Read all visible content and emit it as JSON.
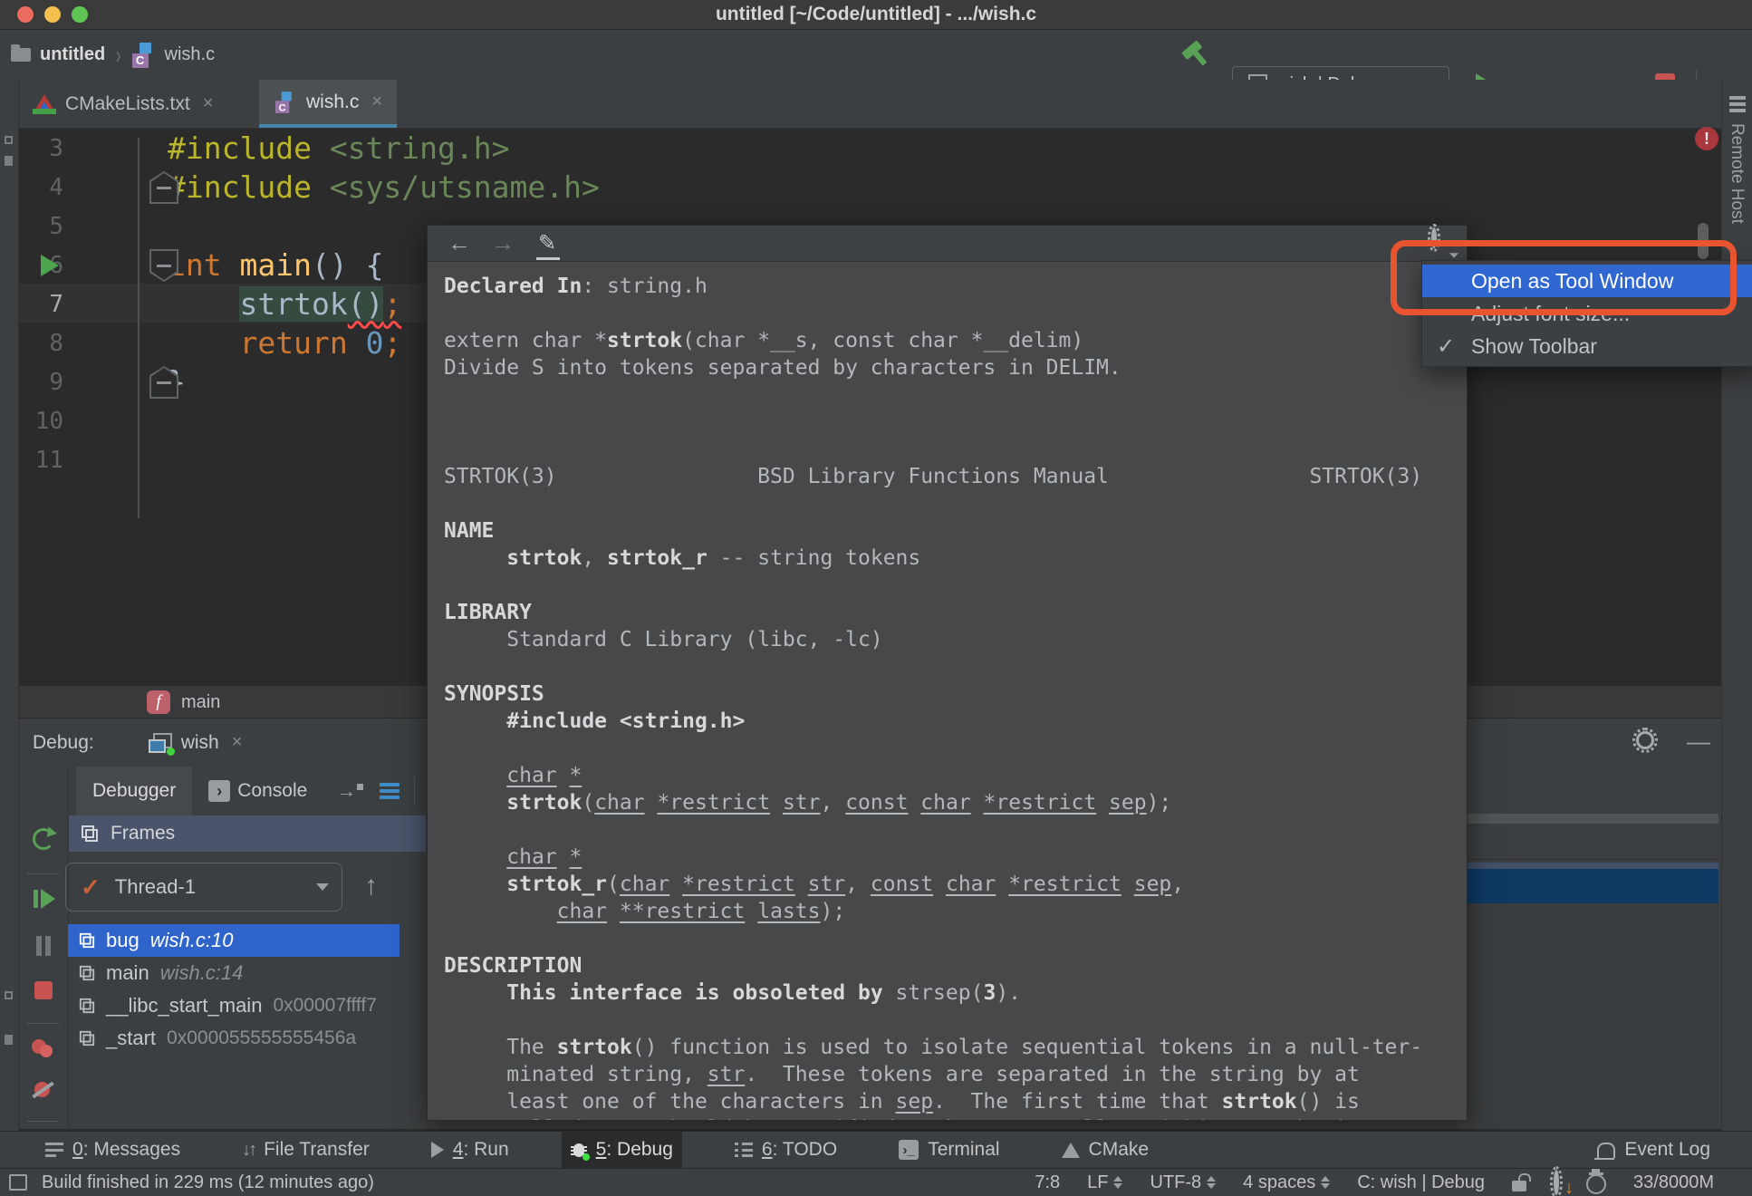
{
  "icons": {
    "back": "←",
    "forward": "→",
    "edit": "✎",
    "close": "×",
    "check": "✓",
    "chevrons": "››",
    "nav_up": "↑",
    "minimize": "—",
    "error_mark": "!",
    "breadcrumb_sep": "›",
    "console_prompt": "›",
    "terminal_prompt": "›_",
    "jump_arrow": "→",
    "file_transfer": "↓↑",
    "gear_down_arrow": "↓"
  },
  "titlebar": {
    "title": "untitled [~/Code/untitled] - .../wish.c"
  },
  "navbar": {
    "project": "untitled",
    "file": "wish.c",
    "run_config": "wish | Debug"
  },
  "editor_tabs": [
    {
      "label": "CMakeLists.txt"
    },
    {
      "label": "wish.c"
    }
  ],
  "editor": {
    "lines": [
      {
        "num": "3",
        "segments": [
          {
            "t": "#include",
            "type": "directive"
          },
          {
            "t": " ",
            "type": "plain"
          },
          {
            "t": "<string.h>",
            "type": "string"
          }
        ]
      },
      {
        "num": "4",
        "fold": "up",
        "segments": [
          {
            "t": "#include",
            "type": "directive"
          },
          {
            "t": " ",
            "type": "plain"
          },
          {
            "t": "<sys/utsname.h>",
            "type": "string"
          }
        ]
      },
      {
        "num": "5",
        "segments": []
      },
      {
        "num": "6",
        "run": true,
        "fold": "down",
        "segments": [
          {
            "t": "int",
            "type": "keyword"
          },
          {
            "t": " ",
            "type": "plain"
          },
          {
            "t": "main",
            "type": "function"
          },
          {
            "t": "() {",
            "type": "plain"
          }
        ]
      },
      {
        "num": "7",
        "current": true,
        "segments": [
          {
            "t": "    ",
            "type": "plain"
          },
          {
            "t": "strtok",
            "type": "plain",
            "hl": true
          },
          {
            "t": "()",
            "type": "plain",
            "hl": true,
            "sq": true
          },
          {
            "t": ";",
            "type": "keyword",
            "sq": true
          }
        ]
      },
      {
        "num": "8",
        "segments": [
          {
            "t": "    ",
            "type": "plain"
          },
          {
            "t": "return",
            "type": "keyword"
          },
          {
            "t": " ",
            "type": "plain"
          },
          {
            "t": "0",
            "type": "number"
          },
          {
            "t": ";",
            "type": "keyword"
          }
        ]
      },
      {
        "num": "9",
        "fold": "up",
        "segments": [
          {
            "t": "}",
            "type": "plain"
          }
        ]
      },
      {
        "num": "10",
        "segments": []
      },
      {
        "num": "11",
        "segments": []
      }
    ]
  },
  "breadcrumb": {
    "function": "main"
  },
  "popup": {
    "man_lines": [
      [
        {
          "t": "Declared In",
          "s": "b"
        },
        {
          "t": ": string.h",
          "s": "n"
        }
      ],
      [],
      [
        {
          "t": "extern char *",
          "s": "n"
        },
        {
          "t": "strtok",
          "s": "b"
        },
        {
          "t": "(char *__s, const char *__delim)",
          "s": "n"
        }
      ],
      [
        {
          "t": "Divide S into tokens separated by characters in DELIM.",
          "s": "n"
        }
      ],
      [],
      [],
      [],
      [
        {
          "t": "STRTOK(3)                BSD Library Functions Manual                STRTOK(3)",
          "s": "n"
        }
      ],
      [],
      [
        {
          "t": "NAME",
          "s": "b"
        }
      ],
      [
        {
          "t": "     ",
          "s": "n"
        },
        {
          "t": "strtok",
          "s": "b"
        },
        {
          "t": ", ",
          "s": "n"
        },
        {
          "t": "strtok_r",
          "s": "b"
        },
        {
          "t": " -- string tokens",
          "s": "n"
        }
      ],
      [],
      [
        {
          "t": "LIBRARY",
          "s": "b"
        }
      ],
      [
        {
          "t": "     Standard C Library (libc, -lc)",
          "s": "n"
        }
      ],
      [],
      [
        {
          "t": "SYNOPSIS",
          "s": "b"
        }
      ],
      [
        {
          "t": "     ",
          "s": "n"
        },
        {
          "t": "#include <string.h>",
          "s": "b"
        }
      ],
      [],
      [
        {
          "t": "     ",
          "s": "n"
        },
        {
          "t": "char",
          "s": "u"
        },
        {
          "t": " ",
          "s": "n"
        },
        {
          "t": "*",
          "s": "u"
        }
      ],
      [
        {
          "t": "     ",
          "s": "n"
        },
        {
          "t": "strtok",
          "s": "b"
        },
        {
          "t": "(",
          "s": "n"
        },
        {
          "t": "char",
          "s": "u"
        },
        {
          "t": " ",
          "s": "n"
        },
        {
          "t": "*restrict",
          "s": "u"
        },
        {
          "t": " ",
          "s": "n"
        },
        {
          "t": "str",
          "s": "u"
        },
        {
          "t": ", ",
          "s": "n"
        },
        {
          "t": "const",
          "s": "u"
        },
        {
          "t": " ",
          "s": "n"
        },
        {
          "t": "char",
          "s": "u"
        },
        {
          "t": " ",
          "s": "n"
        },
        {
          "t": "*restrict",
          "s": "u"
        },
        {
          "t": " ",
          "s": "n"
        },
        {
          "t": "sep",
          "s": "u"
        },
        {
          "t": ");",
          "s": "n"
        }
      ],
      [],
      [
        {
          "t": "     ",
          "s": "n"
        },
        {
          "t": "char",
          "s": "u"
        },
        {
          "t": " ",
          "s": "n"
        },
        {
          "t": "*",
          "s": "u"
        }
      ],
      [
        {
          "t": "     ",
          "s": "n"
        },
        {
          "t": "strtok_r",
          "s": "b"
        },
        {
          "t": "(",
          "s": "n"
        },
        {
          "t": "char",
          "s": "u"
        },
        {
          "t": " ",
          "s": "n"
        },
        {
          "t": "*restrict",
          "s": "u"
        },
        {
          "t": " ",
          "s": "n"
        },
        {
          "t": "str",
          "s": "u"
        },
        {
          "t": ", ",
          "s": "n"
        },
        {
          "t": "const",
          "s": "u"
        },
        {
          "t": " ",
          "s": "n"
        },
        {
          "t": "char",
          "s": "u"
        },
        {
          "t": " ",
          "s": "n"
        },
        {
          "t": "*restrict",
          "s": "u"
        },
        {
          "t": " ",
          "s": "n"
        },
        {
          "t": "sep",
          "s": "u"
        },
        {
          "t": ",",
          "s": "n"
        }
      ],
      [
        {
          "t": "         ",
          "s": "n"
        },
        {
          "t": "char",
          "s": "u"
        },
        {
          "t": " ",
          "s": "n"
        },
        {
          "t": "**restrict",
          "s": "u"
        },
        {
          "t": " ",
          "s": "n"
        },
        {
          "t": "lasts",
          "s": "u"
        },
        {
          "t": ");",
          "s": "n"
        }
      ],
      [],
      [
        {
          "t": "DESCRIPTION",
          "s": "b"
        }
      ],
      [
        {
          "t": "     ",
          "s": "n"
        },
        {
          "t": "This interface is obsoleted by",
          "s": "b"
        },
        {
          "t": " strsep(",
          "s": "n"
        },
        {
          "t": "3",
          "s": "b"
        },
        {
          "t": ").",
          "s": "n"
        }
      ],
      [],
      [
        {
          "t": "     The ",
          "s": "n"
        },
        {
          "t": "strtok",
          "s": "b"
        },
        {
          "t": "() function is used to isolate sequential tokens in a null-ter-",
          "s": "n"
        }
      ],
      [
        {
          "t": "     minated string, ",
          "s": "n"
        },
        {
          "t": "str",
          "s": "u"
        },
        {
          "t": ".  These tokens are separated in the string by at",
          "s": "n"
        }
      ],
      [
        {
          "t": "     least one of the characters in ",
          "s": "n"
        },
        {
          "t": "sep",
          "s": "u"
        },
        {
          "t": ".  The first time that ",
          "s": "n"
        },
        {
          "t": "strtok",
          "s": "b"
        },
        {
          "t": "() is",
          "s": "n"
        }
      ],
      [
        {
          "t": "     called, ",
          "s": "n"
        },
        {
          "t": "str",
          "s": "u"
        },
        {
          "t": " should be specified; subsequent calls, wishing to obtain",
          "s": "n"
        }
      ]
    ]
  },
  "context_menu": {
    "items": [
      {
        "label": "Open as Tool Window",
        "selected": true
      },
      {
        "label": "Adjust font size...",
        "selected": false
      },
      {
        "label": "Show Toolbar",
        "selected": false,
        "checked": true
      }
    ]
  },
  "debug": {
    "label": "Debug:",
    "session": "wish",
    "tabs": [
      {
        "label": "Debugger"
      },
      {
        "label": "Console"
      }
    ],
    "frames_title": "Frames",
    "thread": "Thread-1",
    "frames": [
      {
        "name": "bug",
        "location": "wish.c:10",
        "selected": true
      },
      {
        "name": "main",
        "location": "wish.c:14"
      },
      {
        "name": "__libc_start_main",
        "address": "0x00007ffff7"
      },
      {
        "name": "_start",
        "address": "0x000055555555456a"
      }
    ]
  },
  "bottom_bar": {
    "left": [
      {
        "num": "0",
        "label": "Messages",
        "icon": "align"
      },
      {
        "label": "File Transfer",
        "icon": "updown"
      },
      {
        "num": "4",
        "label": "Run",
        "icon": "play"
      },
      {
        "num": "5",
        "label": "Debug",
        "icon": "bug",
        "active": true
      },
      {
        "num": "6",
        "label": "TODO",
        "icon": "todo"
      },
      {
        "label": "Terminal",
        "icon": "terminal"
      },
      {
        "label": "CMake",
        "icon": "cmake"
      }
    ],
    "right": [
      {
        "label": "Event Log",
        "icon": "bell"
      }
    ]
  },
  "status_bar": {
    "message": "Build finished in 229 ms (12 minutes ago)",
    "items": [
      {
        "text": "7:8",
        "name": "caret-position"
      },
      {
        "text": "LF",
        "updown": true,
        "name": "line-separator"
      },
      {
        "text": "UTF-8",
        "updown": true,
        "name": "file-encoding"
      },
      {
        "text": "4 spaces",
        "updown": true,
        "name": "indent-style"
      },
      {
        "text": "C: wish | Debug",
        "name": "active-run-config"
      },
      {
        "icon": "lock",
        "name": "readonly-toggle"
      },
      {
        "icon": "geardown",
        "name": "highlighting-level"
      },
      {
        "icon": "face",
        "name": "inspections-profile"
      },
      {
        "text": "33/8000M",
        "name": "memory-indicator"
      }
    ]
  },
  "right_stripe": {
    "label": "Remote Host"
  },
  "colors": {
    "accent_blue": "#3067d0",
    "selection_blue": "#2f65ca",
    "annotation_orange": "#e85430",
    "run_green": "#5aa158",
    "stop_red": "#c75450",
    "editor_bg": "#2b2b2b",
    "chrome_bg": "#3c3f41"
  }
}
